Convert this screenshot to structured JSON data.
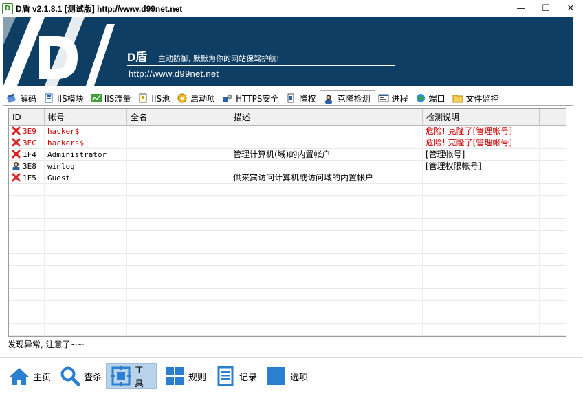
{
  "window": {
    "title": "D盾 v2.1.8.1 [测试版] http://www.d99net.net",
    "app_icon_glyph": "D",
    "controls": {
      "minimize": "—",
      "maximize": "☐",
      "close": "✕"
    }
  },
  "banner": {
    "brand": "D盾",
    "slogan": "主动防御, 默默为你的网站保驾护航!",
    "url": "http://www.d99net.net",
    "bg_color": "#0e3e63"
  },
  "tabs": [
    {
      "label": "解码",
      "icon": "decode-icon"
    },
    {
      "label": "IIS模块",
      "icon": "module-icon"
    },
    {
      "label": "IIS流量",
      "icon": "traffic-icon"
    },
    {
      "label": "IIS池",
      "icon": "pool-icon"
    },
    {
      "label": "启动项",
      "icon": "startup-icon"
    },
    {
      "label": "HTTPS安全",
      "icon": "https-icon"
    },
    {
      "label": "降权",
      "icon": "lower-privilege-icon"
    },
    {
      "label": "克隆检测",
      "icon": "clone-detect-icon",
      "active": true
    },
    {
      "label": "进程",
      "icon": "process-icon"
    },
    {
      "label": "端口",
      "icon": "port-icon"
    },
    {
      "label": "文件监控",
      "icon": "file-monitor-icon"
    }
  ],
  "grid": {
    "columns": [
      "ID",
      "帐号",
      "全名",
      "描述",
      "检测说明"
    ],
    "rows": [
      {
        "id": "3E9",
        "account": "hacker$",
        "fullname": "",
        "desc": "",
        "note": "危险! 克隆了[管理帐号]",
        "danger": true,
        "icon": "red-x-icon"
      },
      {
        "id": "3EC",
        "account": "hackers$",
        "fullname": "",
        "desc": "",
        "note": "危险! 克隆了[管理帐号]",
        "danger": true,
        "icon": "red-x-icon"
      },
      {
        "id": "1F4",
        "account": "Administrator",
        "fullname": "",
        "desc": "管理计算机(域)的内置帐户",
        "note": "[管理帐号]",
        "danger": false,
        "icon": "red-x-icon"
      },
      {
        "id": "3E8",
        "account": "winlog",
        "fullname": "",
        "desc": "",
        "note": "[管理权限帐号]",
        "danger": false,
        "icon": "user-icon"
      },
      {
        "id": "1F5",
        "account": "Guest",
        "fullname": "",
        "desc": "供来宾访问计算机或访问域的内置帐户",
        "note": "",
        "danger": false,
        "icon": "red-x-icon"
      }
    ]
  },
  "status_text": "发现异常, 注意了~~",
  "bottom_buttons": [
    {
      "label": "主页",
      "icon": "home-icon"
    },
    {
      "label": "查杀",
      "icon": "magnifier-icon"
    },
    {
      "label": "工具",
      "icon": "tools-icon",
      "active": true
    },
    {
      "label": "规则",
      "icon": "rules-icon"
    },
    {
      "label": "记录",
      "icon": "log-icon"
    },
    {
      "label": "选项",
      "icon": "options-icon"
    }
  ],
  "colors": {
    "accent_blue": "#2a7fd0",
    "danger_red": "#cc0000",
    "active_bg": "#b9d3ea"
  }
}
